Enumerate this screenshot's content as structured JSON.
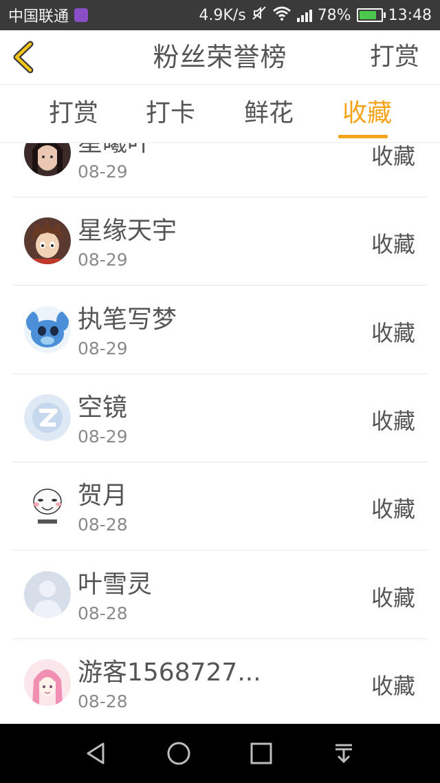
{
  "status_bar": {
    "carrier": "中国联通",
    "speed": "4.9K/s",
    "battery": "78%",
    "time": "13:48",
    "icons": [
      "app-notification-icon",
      "mute-icon",
      "wifi-icon",
      "signal-icon",
      "battery-icon"
    ]
  },
  "header": {
    "back_icon": "chevron-left-icon",
    "title": "粉丝荣誉榜",
    "action": "打赏"
  },
  "tabs": [
    {
      "label": "打赏",
      "active": false
    },
    {
      "label": "打卡",
      "active": false
    },
    {
      "label": "鲜花",
      "active": false
    },
    {
      "label": "收藏",
      "active": true
    }
  ],
  "accent_color": "#f5a31a",
  "list": [
    {
      "name": "星曦叶",
      "date": "08-29",
      "action": "收藏",
      "avatar": "photo-girl"
    },
    {
      "name": "星缘天宇",
      "date": "08-29",
      "action": "收藏",
      "avatar": "anime-boy"
    },
    {
      "name": "执笔写梦",
      "date": "08-29",
      "action": "收藏",
      "avatar": "stitch-cartoon"
    },
    {
      "name": "空镜",
      "date": "08-29",
      "action": "收藏",
      "avatar": "qq-default"
    },
    {
      "name": "贺月",
      "date": "08-28",
      "action": "收藏",
      "avatar": "meme-face"
    },
    {
      "name": "叶雪灵",
      "date": "08-28",
      "action": "收藏",
      "avatar": "default-person"
    },
    {
      "name": "游客1568727...",
      "date": "08-28",
      "action": "收藏",
      "avatar": "pink-anime-girl"
    }
  ],
  "nav_bar": [
    "back-triangle-icon",
    "home-circle-icon",
    "recents-square-icon",
    "notification-pulldown-icon"
  ]
}
